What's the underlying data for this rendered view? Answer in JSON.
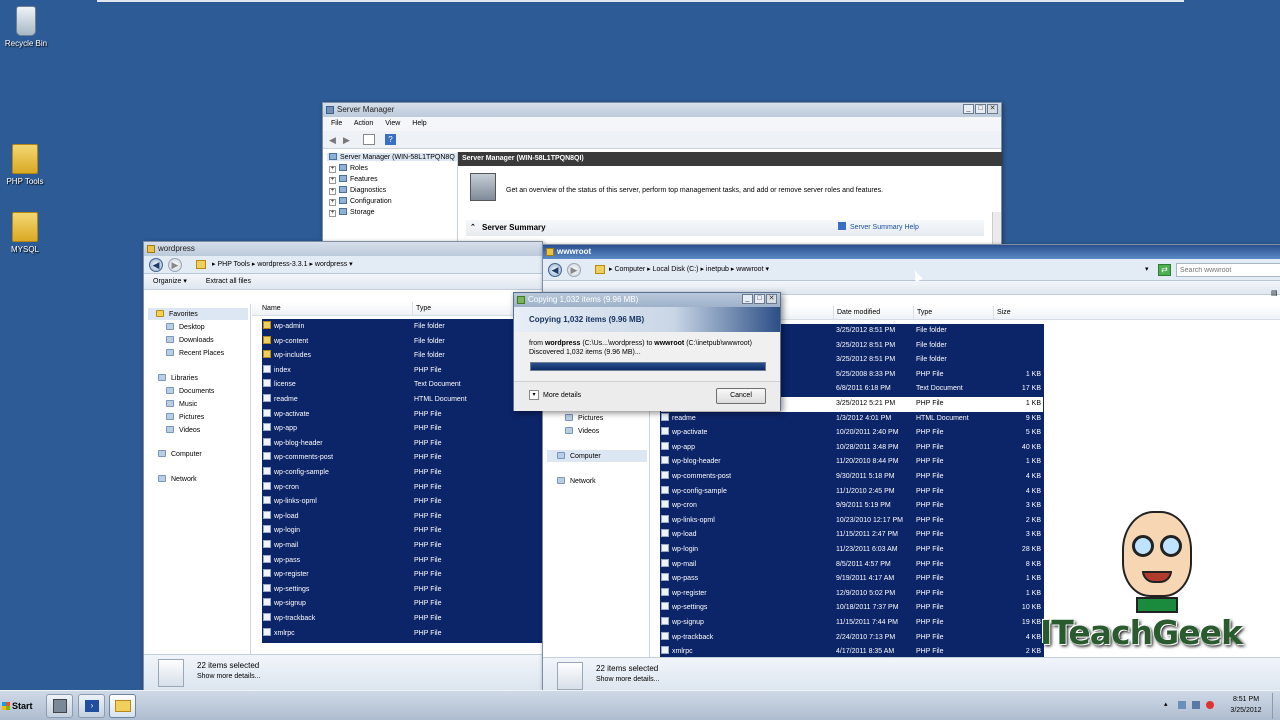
{
  "desktop": {
    "icons": [
      {
        "label": "Recycle Bin",
        "icon": "recycle-bin-icon"
      },
      {
        "label": "PHP Tools",
        "icon": "folder-icon"
      },
      {
        "label": "MYSQL",
        "icon": "folder-icon"
      }
    ]
  },
  "server_manager": {
    "title": "Server Manager",
    "menu": [
      "File",
      "Action",
      "View",
      "Help"
    ],
    "tree": {
      "root": "Server Manager (WIN-58L1TPQN8Q",
      "items": [
        "Roles",
        "Features",
        "Diagnostics",
        "Configuration",
        "Storage"
      ]
    },
    "header": "Server Manager (WIN-58L1TPQN8QI)",
    "overview": "Get an overview of the status of this server, perform top management tasks, and add or remove server roles and features.",
    "summary_label": "Server Summary",
    "summary_help": "Server Summary Help"
  },
  "explorer_left": {
    "title": "wordpress",
    "breadcrumb": [
      "PHP Tools",
      "wordpress-3.3.1",
      "wordpress"
    ],
    "commands": [
      "Organize ▾",
      "Extract all files"
    ],
    "nav": {
      "favorites": "Favorites",
      "fav_items": [
        "Desktop",
        "Downloads",
        "Recent Places"
      ],
      "libraries": "Libraries",
      "lib_items": [
        "Documents",
        "Music",
        "Pictures",
        "Videos"
      ],
      "computer": "Computer",
      "network": "Network"
    },
    "columns": [
      "Name",
      "Type"
    ],
    "files": [
      {
        "name": "wp-admin",
        "type": "File folder",
        "kind": "folder"
      },
      {
        "name": "wp-content",
        "type": "File folder",
        "kind": "folder"
      },
      {
        "name": "wp-includes",
        "type": "File folder",
        "kind": "folder"
      },
      {
        "name": "index",
        "type": "PHP File",
        "kind": "php"
      },
      {
        "name": "license",
        "type": "Text Document",
        "kind": "txt"
      },
      {
        "name": "readme",
        "type": "HTML Document",
        "kind": "html"
      },
      {
        "name": "wp-activate",
        "type": "PHP File",
        "kind": "php"
      },
      {
        "name": "wp-app",
        "type": "PHP File",
        "kind": "php"
      },
      {
        "name": "wp-blog-header",
        "type": "PHP File",
        "kind": "php"
      },
      {
        "name": "wp-comments-post",
        "type": "PHP File",
        "kind": "php"
      },
      {
        "name": "wp-config-sample",
        "type": "PHP File",
        "kind": "php"
      },
      {
        "name": "wp-cron",
        "type": "PHP File",
        "kind": "php"
      },
      {
        "name": "wp-links-opml",
        "type": "PHP File",
        "kind": "php"
      },
      {
        "name": "wp-load",
        "type": "PHP File",
        "kind": "php"
      },
      {
        "name": "wp-login",
        "type": "PHP File",
        "kind": "php"
      },
      {
        "name": "wp-mail",
        "type": "PHP File",
        "kind": "php"
      },
      {
        "name": "wp-pass",
        "type": "PHP File",
        "kind": "php"
      },
      {
        "name": "wp-register",
        "type": "PHP File",
        "kind": "php"
      },
      {
        "name": "wp-settings",
        "type": "PHP File",
        "kind": "php"
      },
      {
        "name": "wp-signup",
        "type": "PHP File",
        "kind": "php"
      },
      {
        "name": "wp-trackback",
        "type": "PHP File",
        "kind": "php"
      },
      {
        "name": "xmlrpc",
        "type": "PHP File",
        "kind": "php"
      }
    ],
    "status": {
      "selected": "22 items selected",
      "details": "Show more details..."
    }
  },
  "explorer_right": {
    "title": "wwwroot",
    "breadcrumb": [
      "Computer",
      "Local Disk (C:)",
      "inetpub",
      "wwwroot"
    ],
    "search_placeholder": "Search wwwroot",
    "nav": {
      "pictures": "Pictures",
      "videos": "Videos",
      "computer": "Computer",
      "network": "Network"
    },
    "columns": [
      "Date modified",
      "Type",
      "Size"
    ],
    "files": [
      {
        "name": "",
        "date": "3/25/2012 8:51 PM",
        "type": "File folder",
        "size": ""
      },
      {
        "name": "",
        "date": "3/25/2012 8:51 PM",
        "type": "File folder",
        "size": ""
      },
      {
        "name": "",
        "date": "3/25/2012 8:51 PM",
        "type": "File folder",
        "size": ""
      },
      {
        "name": "",
        "date": "5/25/2008 8:33 PM",
        "type": "PHP File",
        "size": "1 KB"
      },
      {
        "name": "",
        "date": "6/8/2011 6:18 PM",
        "type": "Text Document",
        "size": "17 KB"
      },
      {
        "name": "",
        "date": "3/25/2012 5:21 PM",
        "type": "PHP File",
        "size": "1 KB"
      },
      {
        "name": "readme",
        "date": "1/3/2012 4:01 PM",
        "type": "HTML Document",
        "size": "9 KB"
      },
      {
        "name": "wp-activate",
        "date": "10/20/2011 2:40 PM",
        "type": "PHP File",
        "size": "5 KB"
      },
      {
        "name": "wp-app",
        "date": "10/28/2011 3:48 PM",
        "type": "PHP File",
        "size": "40 KB"
      },
      {
        "name": "wp-blog-header",
        "date": "11/20/2010 8:44 PM",
        "type": "PHP File",
        "size": "1 KB"
      },
      {
        "name": "wp-comments-post",
        "date": "9/30/2011 5:18 PM",
        "type": "PHP File",
        "size": "4 KB"
      },
      {
        "name": "wp-config-sample",
        "date": "11/1/2010 2:45 PM",
        "type": "PHP File",
        "size": "4 KB"
      },
      {
        "name": "wp-cron",
        "date": "9/9/2011 5:19 PM",
        "type": "PHP File",
        "size": "3 KB"
      },
      {
        "name": "wp-links-opml",
        "date": "10/23/2010 12:17 PM",
        "type": "PHP File",
        "size": "2 KB"
      },
      {
        "name": "wp-load",
        "date": "11/15/2011 2:47 PM",
        "type": "PHP File",
        "size": "3 KB"
      },
      {
        "name": "wp-login",
        "date": "11/23/2011 6:03 AM",
        "type": "PHP File",
        "size": "28 KB"
      },
      {
        "name": "wp-mail",
        "date": "8/5/2011 4:57 PM",
        "type": "PHP File",
        "size": "8 KB"
      },
      {
        "name": "wp-pass",
        "date": "9/19/2011 4:17 AM",
        "type": "PHP File",
        "size": "1 KB"
      },
      {
        "name": "wp-register",
        "date": "12/9/2010 5:02 PM",
        "type": "PHP File",
        "size": "1 KB"
      },
      {
        "name": "wp-settings",
        "date": "10/18/2011 7:37 PM",
        "type": "PHP File",
        "size": "10 KB"
      },
      {
        "name": "wp-signup",
        "date": "11/15/2011 7:44 PM",
        "type": "PHP File",
        "size": "19 KB"
      },
      {
        "name": "wp-trackback",
        "date": "2/24/2010 7:13 PM",
        "type": "PHP File",
        "size": "4 KB"
      },
      {
        "name": "xmlrpc",
        "date": "4/17/2011 8:35 AM",
        "type": "PHP File",
        "size": "2 KB"
      }
    ],
    "status": {
      "selected": "22 items selected",
      "details": "Show more details..."
    }
  },
  "copy_dialog": {
    "title": "Copying 1,032 items (9.96 MB)",
    "heading": "Copying 1,032 items (9.96 MB)",
    "from_prefix": "from",
    "from_source": "wordpress",
    "from_source_path": "(C:\\Us...\\wordpress)",
    "to_word": "to",
    "to_dest": "wwwroot",
    "to_dest_path": "(C:\\inetpub\\wwwroot)",
    "discovered": "Discovered 1,032 items (9.96 MB)...",
    "progress": 1.0,
    "more_details": "More details",
    "cancel": "Cancel"
  },
  "taskbar": {
    "start": "Start",
    "clock_time": "8:51 PM",
    "clock_date": "3/25/2012"
  },
  "watermark": {
    "text": "ITeachGeek"
  },
  "colors": {
    "selection": "#0c2468",
    "desktop": "#2d5b96"
  }
}
